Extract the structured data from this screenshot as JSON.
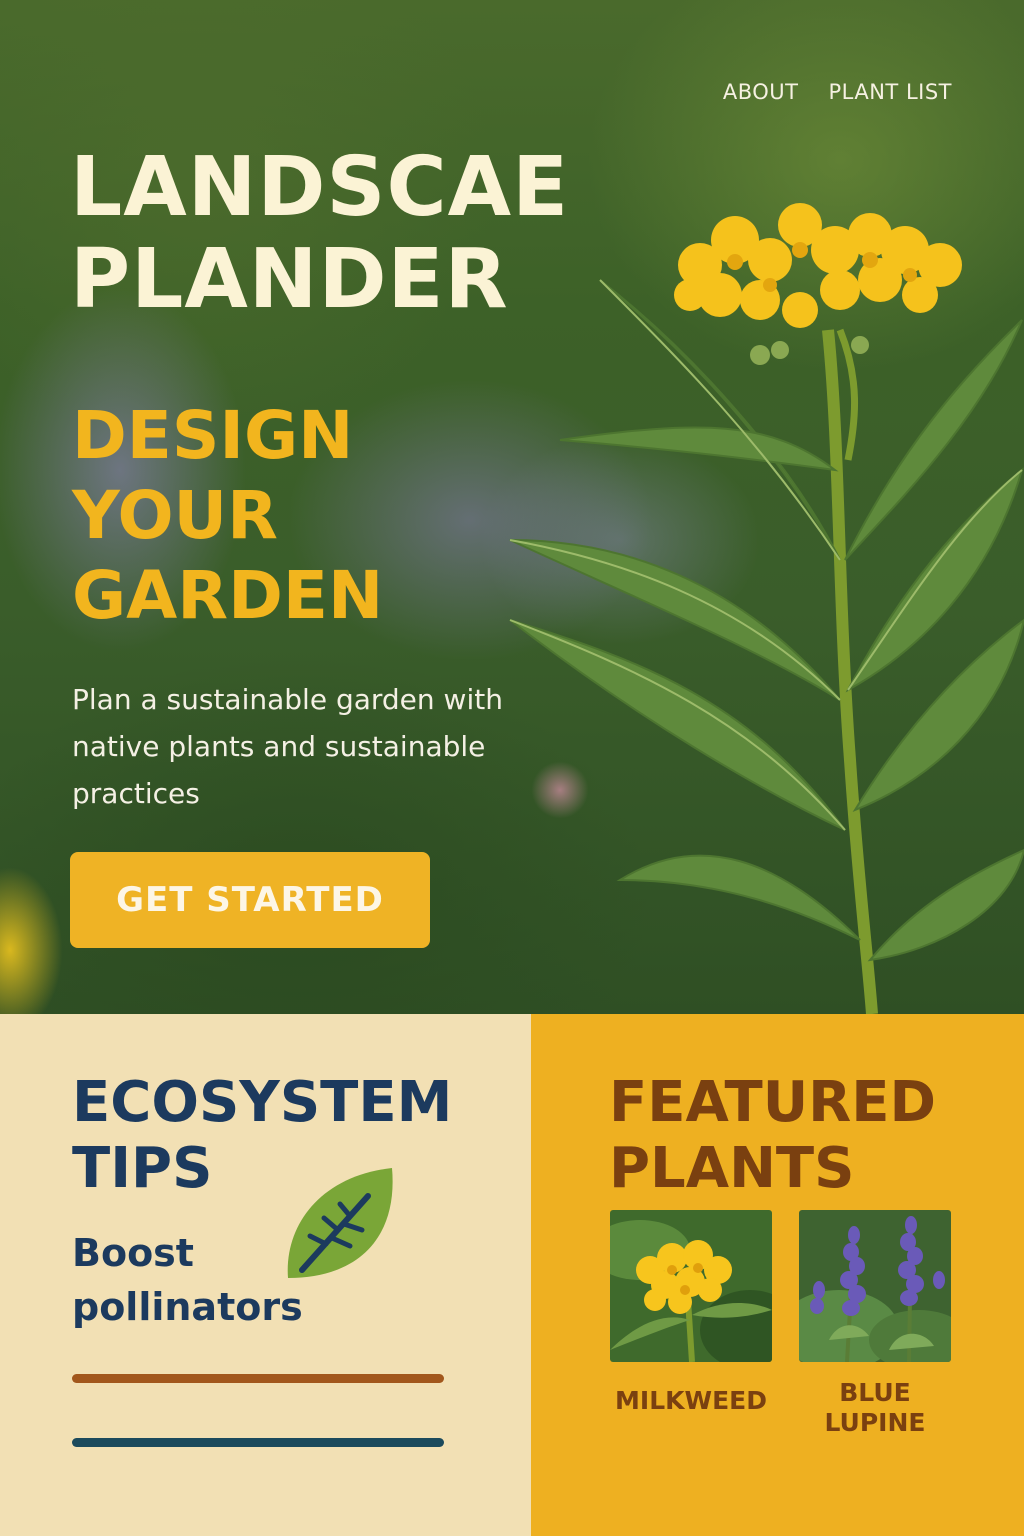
{
  "nav": {
    "items": [
      "ABOUT",
      "PLANT LIST"
    ]
  },
  "hero": {
    "title_line1": "LANDSCAE",
    "title_line2": "PLANDER",
    "headline_line1": "DESIGN",
    "headline_line2": "YOUR",
    "headline_line3": "GARDEN",
    "subtitle": "Plan a sustainable garden with native plants and sustainable practices",
    "cta_label": "GET STARTED"
  },
  "tips": {
    "title_line1": "ECOSYSTEM",
    "title_line2": "TIPS",
    "tip_line1": "Boost",
    "tip_line2": "pollinators",
    "icon": "leaf-icon"
  },
  "featured": {
    "title_line1": "FEATURED",
    "title_line2": "PLANTS",
    "plants": [
      {
        "name": "MILKWEED"
      },
      {
        "name_line1": "BLUE",
        "name_line2": "LUPINE"
      }
    ]
  },
  "colors": {
    "accent_yellow": "#efb325",
    "cream": "#f2e0b4",
    "navy": "#1c3a5e",
    "brown": "#7a4010"
  }
}
